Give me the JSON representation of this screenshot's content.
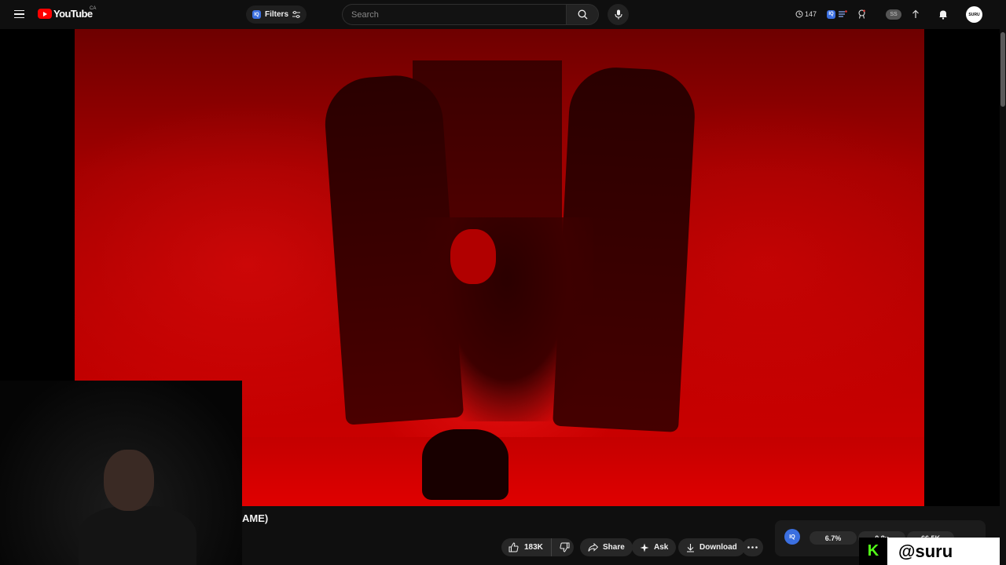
{
  "header": {
    "logo_text": "YouTube",
    "country_code": "CA",
    "filters_label": "Filters",
    "iq_label": "IQ",
    "search": {
      "placeholder": "Search"
    },
    "history_count": "147",
    "ss_label": "SS",
    "avatar_label": "SURU"
  },
  "video": {
    "title_partial": "AME)"
  },
  "actions": {
    "like_count": "183K",
    "share_label": "Share",
    "ask_label": "Ask",
    "download_label": "Download"
  },
  "stats_panel": {
    "iq_label": "IQ",
    "stat_1": "6.7%",
    "stat_2": "0.8x",
    "stat_3": "66.5K"
  },
  "watermark": {
    "platform_icon": "K",
    "handle": "@suru"
  },
  "colors": {
    "background": "#0f0f0f",
    "brand_red": "#ff0000",
    "kick_green": "#53fc18",
    "iq_blue": "#3b6fe0"
  }
}
